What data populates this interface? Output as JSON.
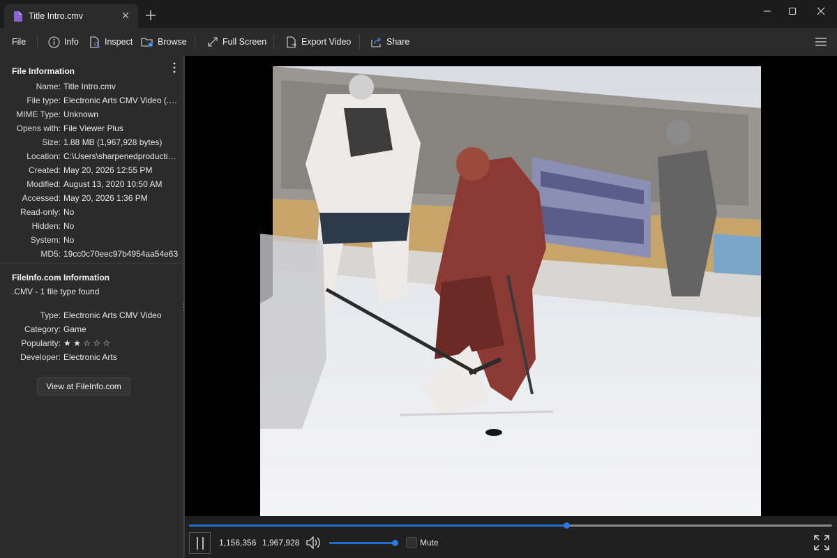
{
  "window": {
    "tab_title": "Title Intro.cmv",
    "new_tab_symbol": "+",
    "controls": [
      "minimize-icon",
      "maximize-icon",
      "close-icon"
    ]
  },
  "toolbar": {
    "file": "File",
    "info": "Info",
    "inspect": "Inspect",
    "browse": "Browse",
    "full_screen": "Full Screen",
    "export_video": "Export Video",
    "share": "Share"
  },
  "file_info": {
    "title": "File Information",
    "rows": [
      {
        "key": "Name:",
        "value": "Title Intro.cmv"
      },
      {
        "key": "File type:",
        "value": "Electronic Arts CMV Video (.cmv)"
      },
      {
        "key": "MIME Type:",
        "value": "Unknown"
      },
      {
        "key": "Opens with:",
        "value": "File Viewer Plus"
      },
      {
        "key": "Size:",
        "value": "1.88 MB (1,967,928 bytes)"
      },
      {
        "key": "Location:",
        "value": "C:\\Users\\sharpenedproductions"
      },
      {
        "key": "Created:",
        "value": "May 20, 2026 12:55 PM"
      },
      {
        "key": "Modified:",
        "value": "August 13, 2020 10:50 AM"
      },
      {
        "key": "Accessed:",
        "value": "May 20, 2026 1:36 PM"
      },
      {
        "key": "Read-only:",
        "value": "No"
      },
      {
        "key": "Hidden:",
        "value": "No"
      },
      {
        "key": "System:",
        "value": "No"
      },
      {
        "key": "MD5:",
        "value": "19cc0c70eec97b4954aa54e63"
      }
    ]
  },
  "fileinfo_com": {
    "title": "FileInfo.com Information",
    "subtitle": ".CMV - 1 file type found",
    "rows": [
      {
        "key": "Type:",
        "value": "Electronic Arts CMV Video"
      },
      {
        "key": "Category:",
        "value": "Game"
      },
      {
        "key": "Popularity:",
        "value": "★ ★ ☆ ☆ ☆"
      },
      {
        "key": "Developer:",
        "value": "Electronic Arts"
      }
    ],
    "rating": 2,
    "rating_max": 5,
    "button": "View at FileInfo.com"
  },
  "player": {
    "position": "1,156,356",
    "length": "1,967,928",
    "progress_fraction": 0.587,
    "volume_fraction": 1.0,
    "mute_label": "Mute",
    "muted": false
  },
  "colors": {
    "accent": "#1f6fd1",
    "doc_icon": "#8a63d2"
  }
}
